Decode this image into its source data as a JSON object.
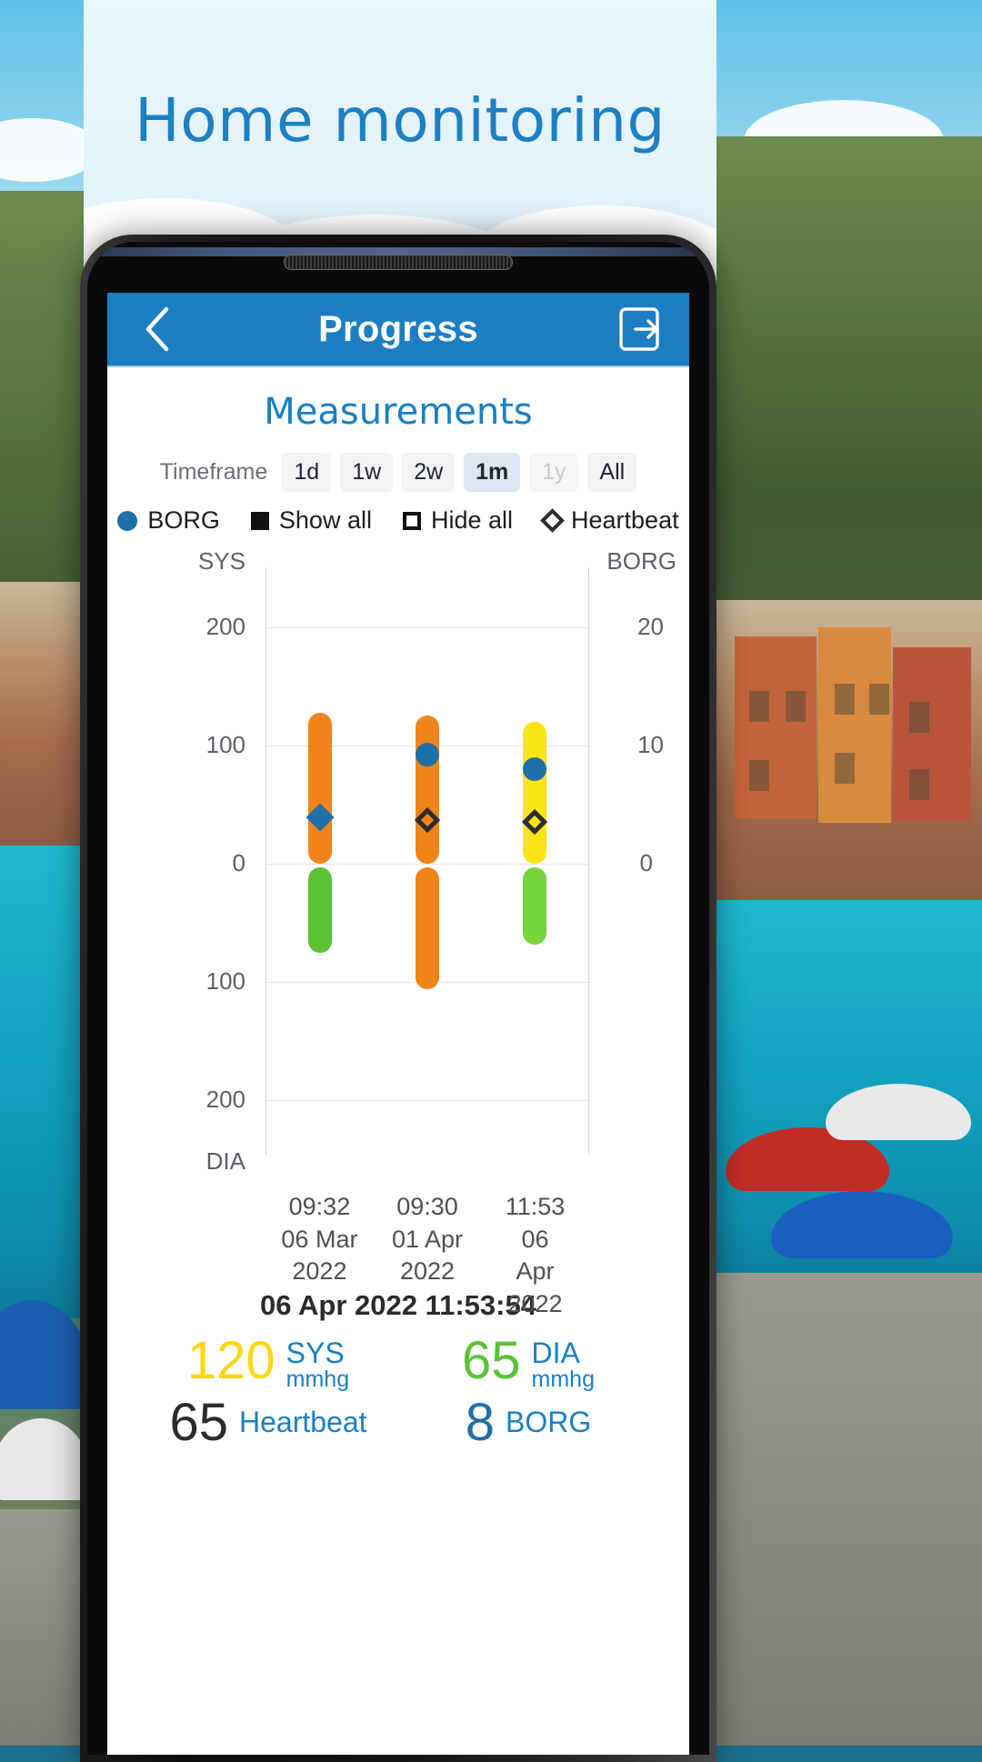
{
  "banner": {
    "title": "Home monitoring"
  },
  "app": {
    "header": {
      "back_icon": "chevron-left-icon",
      "title": "Progress",
      "logout_icon": "logout-icon"
    },
    "section_title": "Measurements"
  },
  "timeframe": {
    "label": "Timeframe",
    "options": [
      {
        "label": "1d",
        "state": "normal"
      },
      {
        "label": "1w",
        "state": "normal"
      },
      {
        "label": "2w",
        "state": "normal"
      },
      {
        "label": "1m",
        "state": "active"
      },
      {
        "label": "1y",
        "state": "disabled"
      },
      {
        "label": "All",
        "state": "normal"
      }
    ]
  },
  "legend": [
    {
      "label": "BORG",
      "marker": "filled-circle-icon",
      "color": "#1f6fa8"
    },
    {
      "label": "Show all",
      "marker": "filled-square-icon",
      "color": "#111111"
    },
    {
      "label": "Hide all",
      "marker": "outline-square-icon",
      "color": "#111111"
    },
    {
      "label": "Heartbeat",
      "marker": "outline-diamond-icon",
      "color": "#2d2d2d"
    }
  ],
  "chart_data": {
    "type": "bar",
    "title": "Measurements",
    "xlabel": "",
    "ylabel": "SYS / DIA",
    "y2label": "BORG",
    "grid": true,
    "legend_position": "top",
    "left_axis": {
      "name_top": "SYS",
      "name_bottom": "DIA",
      "tick_labels": [
        "200",
        "100",
        "0",
        "100",
        "200"
      ],
      "tick_values": [
        200,
        100,
        0,
        -100,
        -200
      ],
      "ylim": [
        -260,
        260
      ]
    },
    "right_axis": {
      "name": "BORG",
      "tick_labels": [
        "20",
        "10",
        "0"
      ],
      "tick_values": [
        20,
        10,
        0
      ],
      "ylim": [
        -26,
        26
      ]
    },
    "categories": [
      "09:32\n06 Mar\n2022",
      "09:30\n01 Apr\n2022",
      "11:53\n06 Apr\n2022"
    ],
    "x_tick_labels": [
      {
        "time": "09:32",
        "date": "06 Mar",
        "year": "2022"
      },
      {
        "time": "09:30",
        "date": "01 Apr",
        "year": "2022"
      },
      {
        "time": "11:53",
        "date": "06 Apr",
        "year": "2022"
      }
    ],
    "series": [
      {
        "name": "SYS",
        "type": "range-bar",
        "colors": [
          "#F08419",
          "#F08419",
          "#FCE514"
        ],
        "values": [
          {
            "low": 0,
            "high": 128,
            "color": "#F08419"
          },
          {
            "low": 0,
            "high": 126,
            "color": "#F08419"
          },
          {
            "low": 0,
            "high": 120,
            "color": "#FCE514"
          }
        ]
      },
      {
        "name": "DIA",
        "type": "range-bar",
        "colors": [
          "#5BC236",
          "#F08419",
          "#77D43F"
        ],
        "values": [
          {
            "low": 0,
            "high": 72,
            "color": "#5BC236"
          },
          {
            "low": 0,
            "high": 103,
            "color": "#F08419"
          },
          {
            "low": 0,
            "high": 65,
            "color": "#77D43F"
          }
        ]
      },
      {
        "name": "BORG",
        "type": "scatter",
        "marker": "circle",
        "color": "#1f6fa8",
        "values": [
          6.2,
          9.3,
          8.0
        ]
      },
      {
        "name": "Heartbeat",
        "type": "scatter",
        "marker": "diamond",
        "color": "#2d2d2d",
        "values": [
          62,
          60,
          65
        ]
      }
    ]
  },
  "reading": {
    "timestamp": "06 Apr 2022 11:53:54",
    "items": [
      {
        "value": "120",
        "label": "SYS",
        "unit": "mmhg",
        "value_color": "#FCD611"
      },
      {
        "value": "65",
        "label": "DIA",
        "unit": "mmhg",
        "value_color": "#5BC236"
      },
      {
        "value": "65",
        "label": "Heartbeat",
        "unit": "",
        "value_color": "#2b2b2b"
      },
      {
        "value": "8",
        "label": "BORG",
        "unit": "",
        "value_color": "#1f6fa8"
      }
    ]
  },
  "colors": {
    "brand_blue": "#1b7ec2",
    "sys_orange": "#F08419",
    "sys_yellow": "#FCE514",
    "dia_green": "#5BC236",
    "borg_blue": "#1f6fa8"
  }
}
